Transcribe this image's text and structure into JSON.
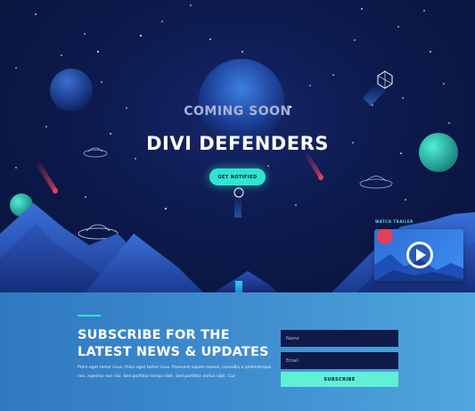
{
  "hero": {
    "kicker": "COMING SOON",
    "title": "DIVI DEFENDERS",
    "notify_label": "GET NOTIFIED"
  },
  "trailer": {
    "label": "WATCH TRAILER",
    "play_icon": "play-icon"
  },
  "subscribe": {
    "title_line1": "SUBSCRIBE FOR THE",
    "title_line2": "LATEST NEWS & UPDATES",
    "body": "Proin eget tortor risus. Proin eget tortor risus. Praesent sapien massa, convallis a pellentesque nec, egestas non nisi. Sed porttitor lectus nibh. Sed porttitor lectus nibh. Cur",
    "name_placeholder": "Name",
    "email_placeholder": "Email",
    "button_label": "SUBSCRIBE"
  },
  "colors": {
    "hero_bg": "#0c1a4d",
    "accent": "#2ee6cf",
    "subscribe_bg": "#3f8ccf",
    "field_bg": "#101a48"
  }
}
